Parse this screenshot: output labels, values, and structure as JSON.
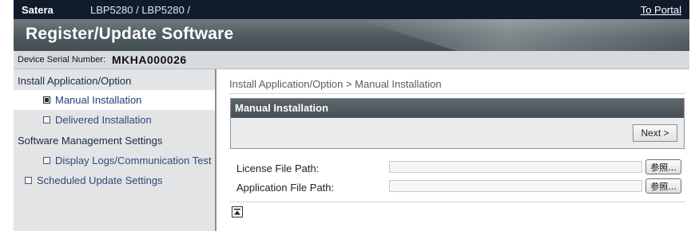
{
  "topbar": {
    "brand": "Satera",
    "model": "LBP5280 / LBP5280 /",
    "portal_link": "To Portal"
  },
  "banner": {
    "title": "Register/Update Software"
  },
  "device": {
    "serial_label": "Device Serial Number:",
    "serial_value": "MKHA000026"
  },
  "sidebar": {
    "install_header": "Install Application/Option",
    "manual_installation": "Manual Installation",
    "delivered_installation": "Delivered Installation",
    "software_header": "Software Management Settings",
    "display_logs": "Display Logs/Communication Test",
    "scheduled_update": "Scheduled Update Settings"
  },
  "main": {
    "breadcrumb": "Install Application/Option > Manual Installation",
    "panel_title": "Manual Installation",
    "next_button": "Next >",
    "license_label": "License File Path:",
    "license_value": "",
    "application_label": "Application File Path:",
    "application_value": "",
    "browse_label": "参照..."
  },
  "icons": {
    "sidebar_bullet": "square-bullet-icon",
    "back_to_top": "back-to-top-icon"
  },
  "colors": {
    "topbar": "#101c2c",
    "banner": "#5a6468",
    "panel_header": "#4f595e",
    "sidebar_bg": "#e3e4e5",
    "link": "#2e4a7d"
  }
}
